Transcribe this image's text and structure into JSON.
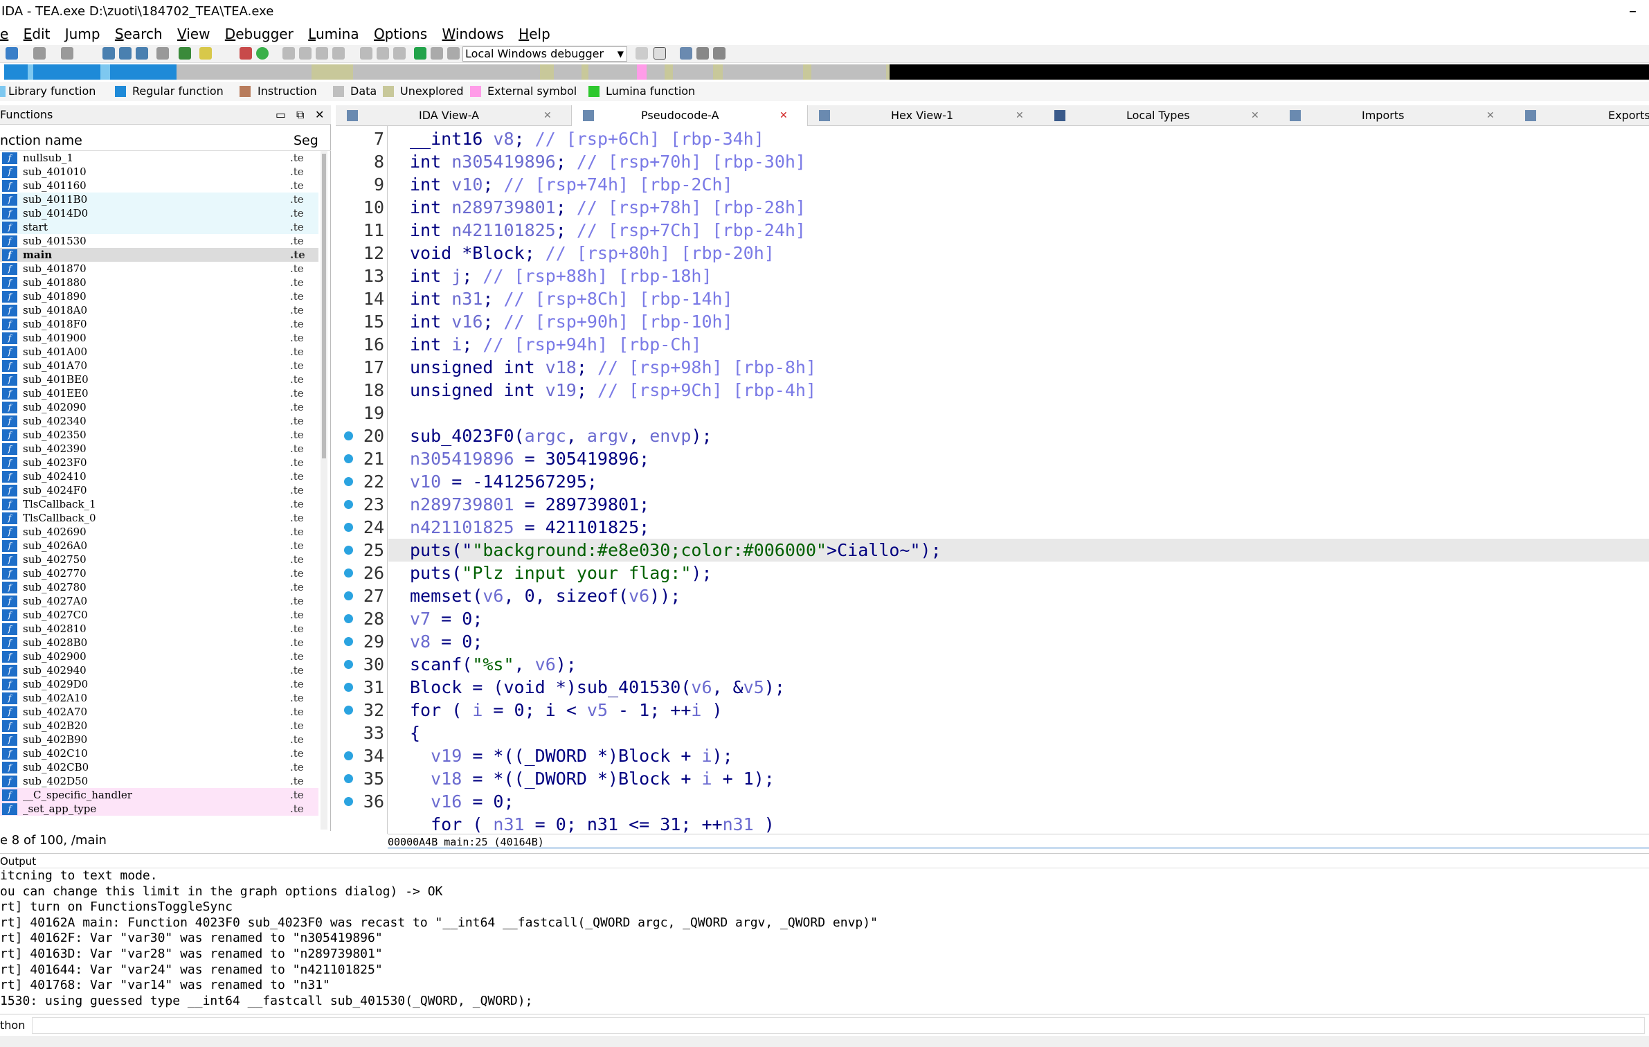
{
  "title": "IDA - TEA.exe D:\\zuoti\\184702_TEA\\TEA.exe",
  "menu": [
    "e",
    "Edit",
    "Jump",
    "Search",
    "View",
    "Debugger",
    "Lumina",
    "Options",
    "Windows",
    "Help"
  ],
  "debugger_select": "Local Windows debugger",
  "legend": [
    {
      "label": "Library function",
      "color": "#7ec8f0"
    },
    {
      "label": "Regular function",
      "color": "#1e8ad8"
    },
    {
      "label": "Instruction",
      "color": "#b87c5c"
    },
    {
      "label": "Data",
      "color": "#bfbfbf"
    },
    {
      "label": "Unexplored",
      "color": "#c8c89a"
    },
    {
      "label": "External symbol",
      "color": "#ff9ce8"
    },
    {
      "label": "Lumina function",
      "color": "#2ec82e"
    }
  ],
  "functions_panel": {
    "title": "Functions",
    "col_name": "nction name",
    "col_seg": "Seg",
    "status": "e 8 of 100, /main",
    "items": [
      {
        "name": "nullsub_1",
        "seg": ".te"
      },
      {
        "name": "sub_401010",
        "seg": ".te"
      },
      {
        "name": "sub_401160",
        "seg": ".te"
      },
      {
        "name": "sub_4011B0",
        "seg": ".te"
      },
      {
        "name": "sub_4014D0",
        "seg": ".te"
      },
      {
        "name": "start",
        "seg": ".te"
      },
      {
        "name": "sub_401530",
        "seg": ".te"
      },
      {
        "name": "main",
        "seg": ".te"
      },
      {
        "name": "sub_401870",
        "seg": ".te"
      },
      {
        "name": "sub_401880",
        "seg": ".te"
      },
      {
        "name": "sub_401890",
        "seg": ".te"
      },
      {
        "name": "sub_4018A0",
        "seg": ".te"
      },
      {
        "name": "sub_4018F0",
        "seg": ".te"
      },
      {
        "name": "sub_401900",
        "seg": ".te"
      },
      {
        "name": "sub_401A00",
        "seg": ".te"
      },
      {
        "name": "sub_401A70",
        "seg": ".te"
      },
      {
        "name": "sub_401BE0",
        "seg": ".te"
      },
      {
        "name": "sub_401EE0",
        "seg": ".te"
      },
      {
        "name": "sub_402090",
        "seg": ".te"
      },
      {
        "name": "sub_402340",
        "seg": ".te"
      },
      {
        "name": "sub_402350",
        "seg": ".te"
      },
      {
        "name": "sub_402390",
        "seg": ".te"
      },
      {
        "name": "sub_4023F0",
        "seg": ".te"
      },
      {
        "name": "sub_402410",
        "seg": ".te"
      },
      {
        "name": "sub_4024F0",
        "seg": ".te"
      },
      {
        "name": "TlsCallback_1",
        "seg": ".te"
      },
      {
        "name": "TlsCallback_0",
        "seg": ".te"
      },
      {
        "name": "sub_402690",
        "seg": ".te"
      },
      {
        "name": "sub_4026A0",
        "seg": ".te"
      },
      {
        "name": "sub_402750",
        "seg": ".te"
      },
      {
        "name": "sub_402770",
        "seg": ".te"
      },
      {
        "name": "sub_402780",
        "seg": ".te"
      },
      {
        "name": "sub_4027A0",
        "seg": ".te"
      },
      {
        "name": "sub_4027C0",
        "seg": ".te"
      },
      {
        "name": "sub_402810",
        "seg": ".te"
      },
      {
        "name": "sub_4028B0",
        "seg": ".te"
      },
      {
        "name": "sub_402900",
        "seg": ".te"
      },
      {
        "name": "sub_402940",
        "seg": ".te"
      },
      {
        "name": "sub_4029D0",
        "seg": ".te"
      },
      {
        "name": "sub_402A10",
        "seg": ".te"
      },
      {
        "name": "sub_402A70",
        "seg": ".te"
      },
      {
        "name": "sub_402B20",
        "seg": ".te"
      },
      {
        "name": "sub_402B90",
        "seg": ".te"
      },
      {
        "name": "sub_402C10",
        "seg": ".te"
      },
      {
        "name": "sub_402CB0",
        "seg": ".te"
      },
      {
        "name": "sub_402D50",
        "seg": ".te"
      },
      {
        "name": "__C_specific_handler",
        "seg": ".te"
      },
      {
        "name": "_set_app_type",
        "seg": ".te"
      }
    ]
  },
  "tabs": [
    {
      "label": "IDA View-A"
    },
    {
      "label": "Pseudocode-A"
    },
    {
      "label": "Hex View-1"
    },
    {
      "label": "Local Types"
    },
    {
      "label": "Imports"
    },
    {
      "label": "Exports"
    }
  ],
  "code_lines": [
    {
      "n": "7",
      "text": "__int16 v8; // [rsp+6Ch] [rbp-34h]",
      "dot": false
    },
    {
      "n": "8",
      "text": "int n305419896; // [rsp+70h] [rbp-30h]",
      "dot": false
    },
    {
      "n": "9",
      "text": "int v10; // [rsp+74h] [rbp-2Ch]",
      "dot": false
    },
    {
      "n": "10",
      "text": "int n289739801; // [rsp+78h] [rbp-28h]",
      "dot": false
    },
    {
      "n": "11",
      "text": "int n421101825; // [rsp+7Ch] [rbp-24h]",
      "dot": false
    },
    {
      "n": "12",
      "text": "void *Block; // [rsp+80h] [rbp-20h]",
      "dot": false
    },
    {
      "n": "13",
      "text": "int j; // [rsp+88h] [rbp-18h]",
      "dot": false
    },
    {
      "n": "14",
      "text": "int n31; // [rsp+8Ch] [rbp-14h]",
      "dot": false
    },
    {
      "n": "15",
      "text": "int v16; // [rsp+90h] [rbp-10h]",
      "dot": false
    },
    {
      "n": "16",
      "text": "int i; // [rsp+94h] [rbp-Ch]",
      "dot": false
    },
    {
      "n": "17",
      "text": "unsigned int v18; // [rsp+98h] [rbp-8h]",
      "dot": false
    },
    {
      "n": "18",
      "text": "unsigned int v19; // [rsp+9Ch] [rbp-4h]",
      "dot": false
    },
    {
      "n": "19",
      "text": "",
      "dot": false
    },
    {
      "n": "20",
      "text": "sub_4023F0(argc, argv, envp);",
      "dot": true
    },
    {
      "n": "21",
      "text": "n305419896 = 305419896;",
      "dot": true
    },
    {
      "n": "22",
      "text": "v10 = -1412567295;",
      "dot": true
    },
    {
      "n": "23",
      "text": "n289739801 = 289739801;",
      "dot": true
    },
    {
      "n": "24",
      "text": "n421101825 = 421101825;",
      "dot": true
    },
    {
      "n": "25",
      "text": "puts(\"Ciallo~\");",
      "dot": true
    },
    {
      "n": "26",
      "text": "puts(\"Plz input your flag:\");",
      "dot": true
    },
    {
      "n": "27",
      "text": "memset(v6, 0, sizeof(v6));",
      "dot": true
    },
    {
      "n": "28",
      "text": "v7 = 0;",
      "dot": true
    },
    {
      "n": "29",
      "text": "v8 = 0;",
      "dot": true
    },
    {
      "n": "30",
      "text": "scanf(\"%s\", v6);",
      "dot": true
    },
    {
      "n": "31",
      "text": "Block = (void *)sub_401530(v6, &v5);",
      "dot": true
    },
    {
      "n": "32",
      "text": "for ( i = 0; i < v5 - 1; ++i )",
      "dot": true
    },
    {
      "n": "33",
      "text": "{",
      "dot": false
    },
    {
      "n": "34",
      "text": "  v19 = *((_DWORD *)Block + i);",
      "dot": true
    },
    {
      "n": "35",
      "text": "  v18 = *((_DWORD *)Block + i + 1);",
      "dot": true
    },
    {
      "n": "36",
      "text": "  v16 = 0;",
      "dot": true
    },
    {
      "n": "",
      "text": "  for ( n31 = 0; n31 <= 31; ++n31 )",
      "dot": false
    }
  ],
  "highlighted_line": "25",
  "editor_status": "00000A4B main:25 (40164B)",
  "output_panel": {
    "title": "Output",
    "lines": [
      "itcning to text mode.",
      "ou can change this limit in the graph options dialog) -> OK",
      "rt] turn on FunctionsToggleSync",
      "rt] 40162A main: Function 4023F0 sub_4023F0 was recast to \"__int64 __fastcall(_QWORD argc, _QWORD argv, _QWORD envp)\"",
      "rt] 40162F: Var \"var30\" was renamed to \"n305419896\"",
      "rt] 40163D: Var \"var28\" was renamed to \"n289739801\"",
      "rt] 401644: Var \"var24\" was renamed to \"n421101825\"",
      "rt] 401768: Var \"var14\" was renamed to \"n31\"",
      "1530: using guessed type __int64 __fastcall sub_401530(_QWORD, _QWORD);"
    ]
  },
  "python_label": "thon"
}
